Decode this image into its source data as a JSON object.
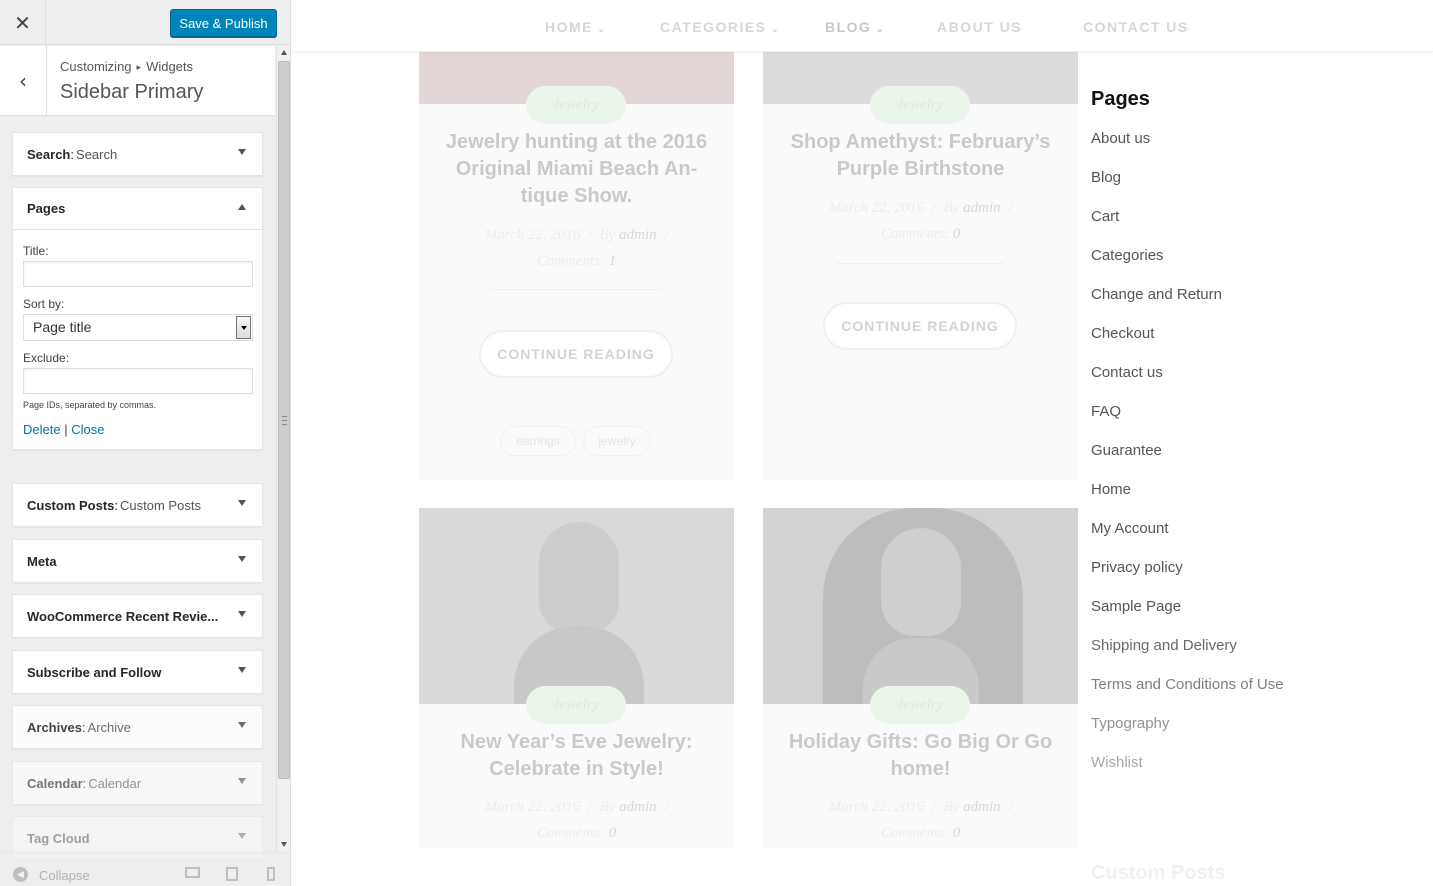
{
  "customizer": {
    "close_icon": "close-icon",
    "publish_label": "Save & Publish",
    "breadcrumb": [
      "Customizing",
      "Widgets"
    ],
    "breadcrumb_sep": "▸",
    "section_title": "Sidebar Primary",
    "widgets": {
      "search": {
        "name": "Search",
        "title": "Search"
      },
      "pages": {
        "name": "Pages",
        "title_label": "Title:",
        "title_value": "",
        "sort_label": "Sort by:",
        "sort_value": "Page title",
        "exclude_label": "Exclude:",
        "exclude_value": "",
        "help": "Page IDs, separated by commas.",
        "delete_label": "Delete",
        "link_sep": "|",
        "close_label": "Close"
      },
      "custom_posts": {
        "name": "Custom Posts",
        "title": "Custom Posts"
      },
      "meta": {
        "name": "Meta"
      },
      "woo": {
        "name": "WooCommerce Recent Revie..."
      },
      "subscribe": {
        "name": "Subscribe and Follow"
      },
      "archives": {
        "name": "Archives",
        "title": "Archive"
      },
      "calendar": {
        "name": "Calendar",
        "title": "Calendar"
      },
      "tagcloud": {
        "name": "Tag Cloud"
      }
    },
    "footer": {
      "collapse_label": "Collapse"
    },
    "colors": {
      "primary": "#0085ba",
      "link": "#0073aa"
    }
  },
  "preview": {
    "nav": [
      "HOME",
      "CATEGORIES",
      "BLOG",
      "ABOUT US",
      "CONTACT US"
    ],
    "posts": [
      {
        "tag": "Jewelry",
        "title": "Jewelry hunting at the 2016 Original Miami Beach An-tique Show.",
        "date": "March 22, 2016",
        "by": "By",
        "author": "admin",
        "comments_label": "Comments:",
        "comments": "1",
        "read_more": "CONTINUE READING",
        "tags": [
          "earrings",
          "jewelry"
        ]
      },
      {
        "tag": "Jewelry",
        "title": "Shop Amethyst: February’s Purple Birthstone",
        "date": "March 22, 2016",
        "by": "By",
        "author": "admin",
        "comments_label": "Comments:",
        "comments": "0",
        "read_more": "CONTINUE READING"
      },
      {
        "tag": "Jewelry",
        "title": "New Year’s Eve Jewelry: Celebrate in Style!",
        "date": "March 22, 2016",
        "by": "By",
        "author": "admin",
        "comments_label": "Comments:",
        "comments": "0"
      },
      {
        "tag": "Jewelry",
        "title": "Holiday Gifts: Go Big Or Go home!",
        "date": "March 22, 2016",
        "by": "By",
        "author": "admin",
        "comments_label": "Comments:",
        "comments": "0"
      }
    ],
    "sidebar": {
      "pages_heading": "Pages",
      "pages": [
        "About us",
        "Blog",
        "Cart",
        "Categories",
        "Change and Return",
        "Checkout",
        "Contact us",
        "FAQ",
        "Guarantee",
        "Home",
        "My Account",
        "Privacy policy",
        "Sample Page",
        "Shipping and Delivery",
        "Terms and Conditions of Use",
        "Typography",
        "Wishlist"
      ],
      "custom_posts_heading": "Custom Posts"
    }
  }
}
